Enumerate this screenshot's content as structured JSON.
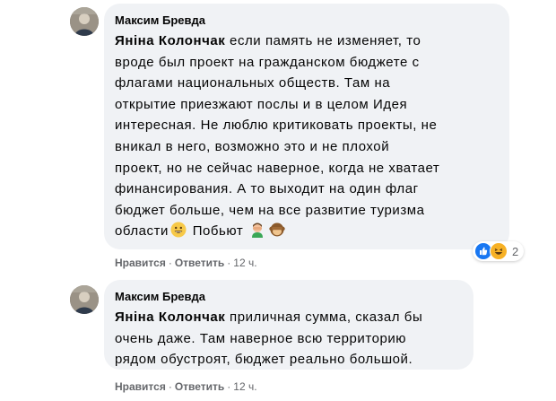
{
  "comments": [
    {
      "author": "Максим Бревда",
      "mention": "Яніна Колончак",
      "text_lines": [
        " если память не изменяет, то",
        "вроде был проект на гражданском бюджете с",
        "флагами национальных обществ. Там на",
        "открытие приезжают послы и в целом Идея",
        "интересная. Не люблю критиковать проекты, не",
        "вникал в него, возможно это и не плохой",
        "проект, но не сейчас наверное, когда не хватает",
        "финансирования. А то выходит на один флаг",
        "бюджет больше, чем на все развитие туризма",
        "области"
      ],
      "tail_text": "Побьют",
      "emojis": [
        "smiling-face-icon",
        "man-facepalming-icon",
        "see-no-evil-monkey-icon"
      ],
      "like_label": "Нравится",
      "reply_label": "Ответить",
      "time": "12 ч.",
      "reaction_icons": [
        "like-reaction-icon",
        "haha-reaction-icon"
      ],
      "reaction_count": "2"
    },
    {
      "author": "Максим Бревда",
      "mention": "Яніна Колончак",
      "text_lines": [
        " приличная сумма, сказал бы",
        "очень даже. Там наверное всю территорию",
        "рядом обустроят, бюджет реально большой."
      ],
      "like_label": "Нравится",
      "reply_label": "Ответить",
      "time": "12 ч."
    }
  ],
  "colors": {
    "bubble": "#f0f2f5",
    "text": "#050505",
    "secondary": "#65676b",
    "like_blue": "#1877f2",
    "haha_yellow": "#f7b125"
  }
}
